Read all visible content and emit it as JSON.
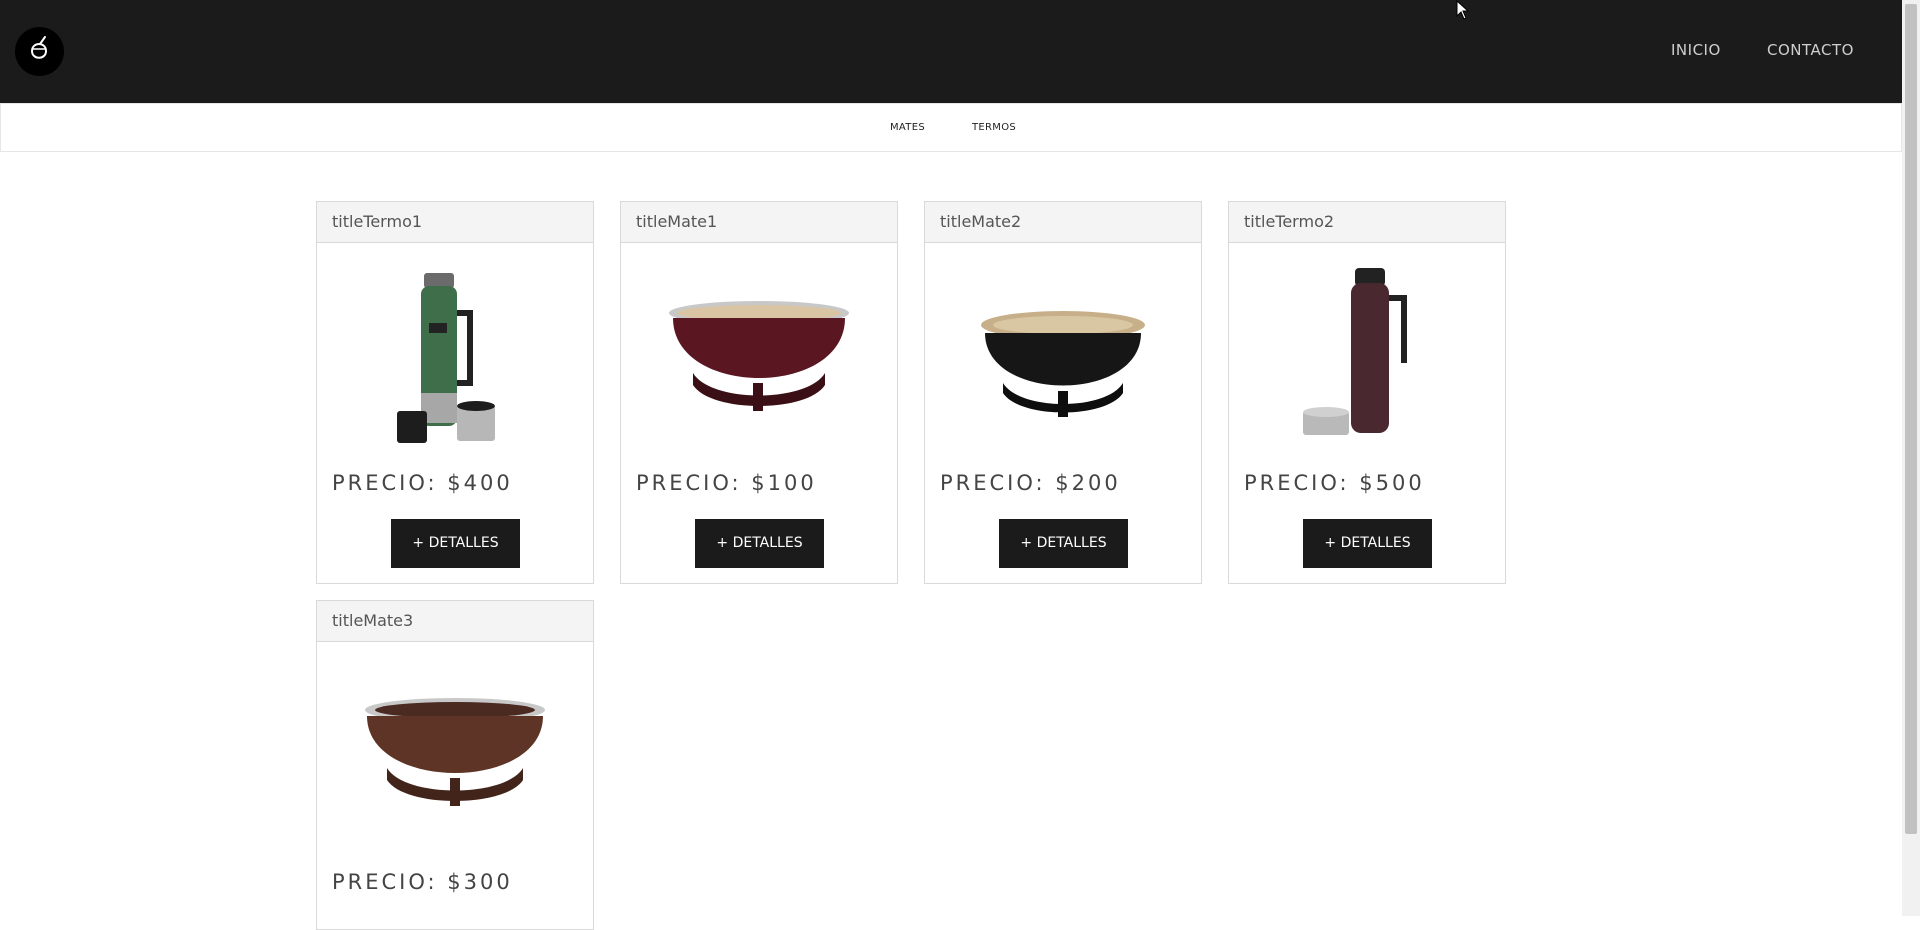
{
  "header": {
    "logo_icon": "mate-gourd-icon",
    "nav": [
      {
        "label": "INICIO"
      },
      {
        "label": "CONTACTO"
      }
    ]
  },
  "subnav": {
    "items": [
      {
        "label": "MATES"
      },
      {
        "label": "TERMOS"
      }
    ]
  },
  "products": [
    {
      "title": "titleTermo1",
      "price": "PRECIO: $400",
      "button": "+ DETALLES",
      "image_icon": "green-thermos-image"
    },
    {
      "title": "titleMate1",
      "price": "PRECIO: $100",
      "button": "+ DETALLES",
      "image_icon": "burgundy-mate-image"
    },
    {
      "title": "titleMate2",
      "price": "PRECIO: $200",
      "button": "+ DETALLES",
      "image_icon": "black-mate-image"
    },
    {
      "title": "titleTermo2",
      "price": "PRECIO: $500",
      "button": "+ DETALLES",
      "image_icon": "maroon-thermos-image"
    },
    {
      "title": "titleMate3",
      "price": "PRECIO: $300",
      "button": "+ DETALLES",
      "image_icon": "brown-mate-image"
    }
  ],
  "colors": {
    "header_bg": "#1b1b1b",
    "button_bg": "#1b1b1b",
    "card_header_bg": "#f4f4f4"
  }
}
